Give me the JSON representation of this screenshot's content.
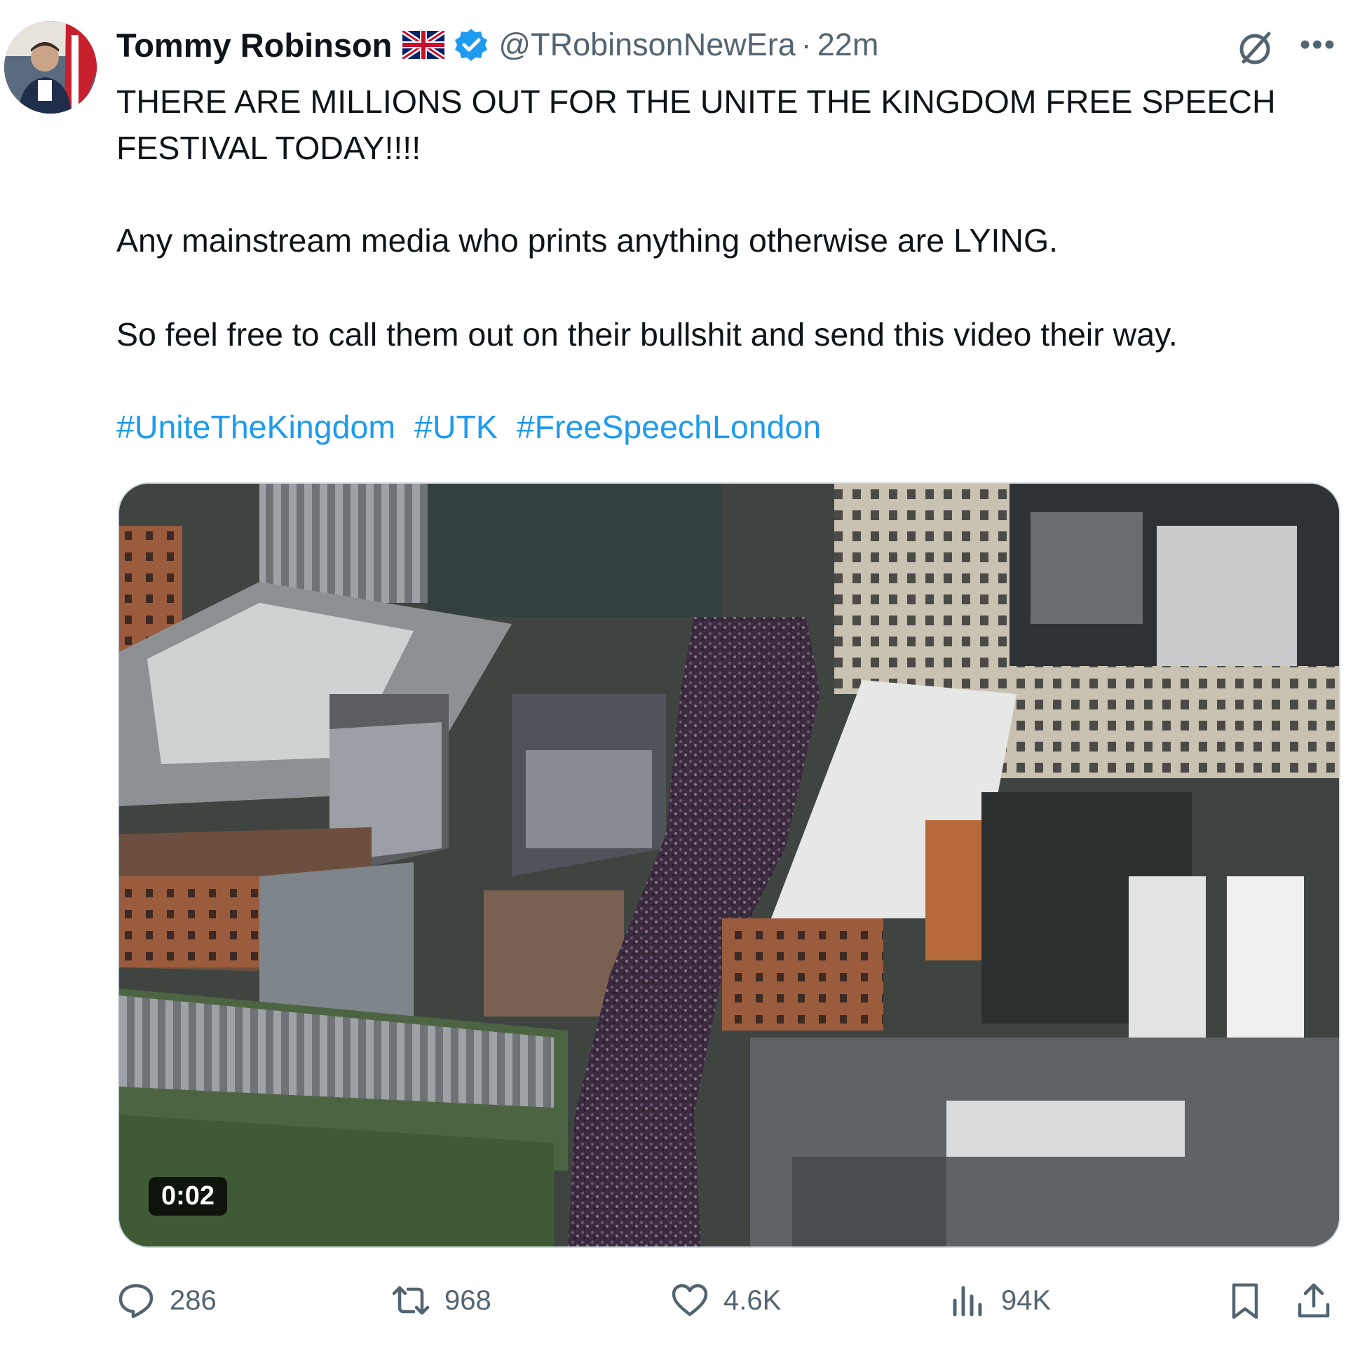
{
  "author": {
    "name": "Tommy Robinson",
    "handle": "@TRobinsonNewEra",
    "separator": "·",
    "time": "22m"
  },
  "icons": {
    "flag": "uk-flag-icon",
    "verified": "verified-badge-icon",
    "grok": "grok-icon",
    "more": "more-options-icon"
  },
  "tweet": {
    "line1": "THERE ARE MILLIONS OUT FOR THE UNITE THE KINGDOM FREE SPEECH",
    "line2": "FESTIVAL TODAY!!!!",
    "line3": "Any mainstream media who prints anything otherwise are LYING.",
    "line4": "So feel free to call them out on their bullshit and send this video their way.",
    "hashtags": [
      "#UniteTheKingdom",
      "#UTK",
      "#FreeSpeechLondon"
    ]
  },
  "media": {
    "duration": "0:02"
  },
  "actions": {
    "replies": "286",
    "reposts": "968",
    "likes": "4.6K",
    "views": "94K"
  },
  "colors": {
    "text": "#0f1419",
    "secondary": "#536471",
    "link": "#1d9bf0",
    "verified": "#1d9bf0"
  }
}
